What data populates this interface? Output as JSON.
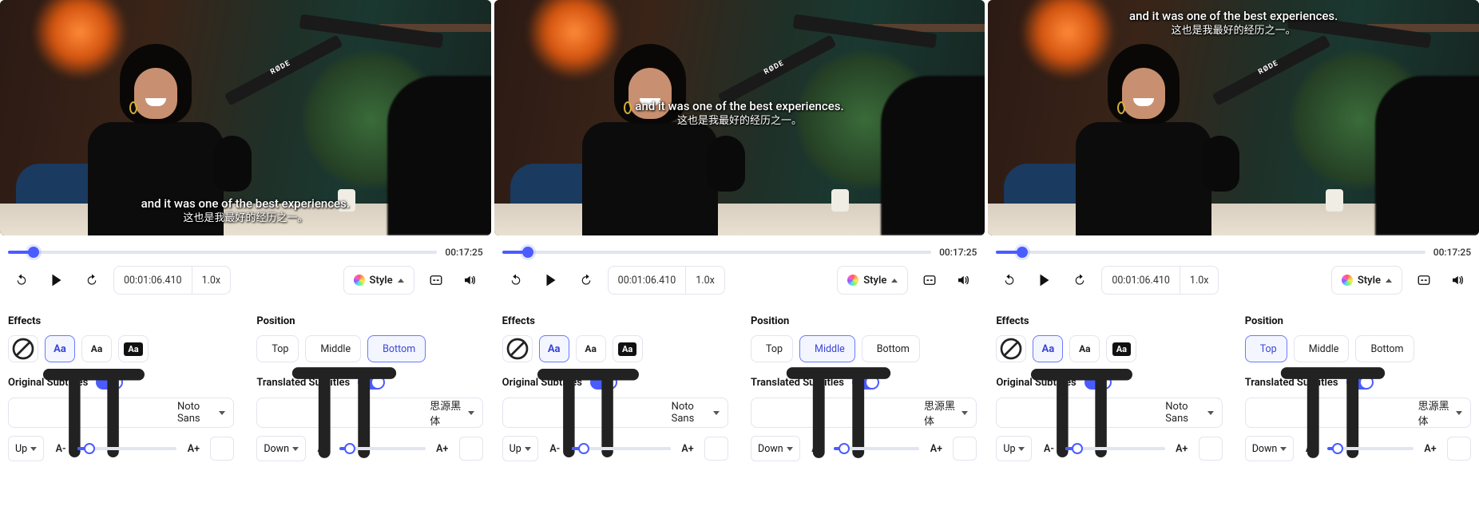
{
  "subtitle": {
    "original": "and it was one of the best experiences.",
    "translated": "这也是我最好的经历之一。"
  },
  "playback": {
    "total_time": "00:17:25",
    "current_time": "00:01:06.410",
    "speed": "1.0x",
    "progress_percent": 6
  },
  "labels": {
    "style": "Style",
    "effects": "Effects",
    "position": "Position",
    "original_subtitles": "Original Subtitles",
    "translated_subtitles": "Translated Subtitles"
  },
  "effects": {
    "options": [
      "none",
      "outline",
      "plain",
      "box"
    ],
    "selected": "outline"
  },
  "position": {
    "options": {
      "top": "Top",
      "middle": "Middle",
      "bottom": "Bottom"
    }
  },
  "fonts": {
    "original": "Noto Sans",
    "translated": "思源黑体"
  },
  "adjust": {
    "up": "Up",
    "down": "Down",
    "size_minus": "A-",
    "size_plus": "A+",
    "slider_percent": 12
  },
  "mic_brand": "RØDE",
  "panels": [
    {
      "position_selected": "bottom"
    },
    {
      "position_selected": "middle"
    },
    {
      "position_selected": "top"
    }
  ]
}
